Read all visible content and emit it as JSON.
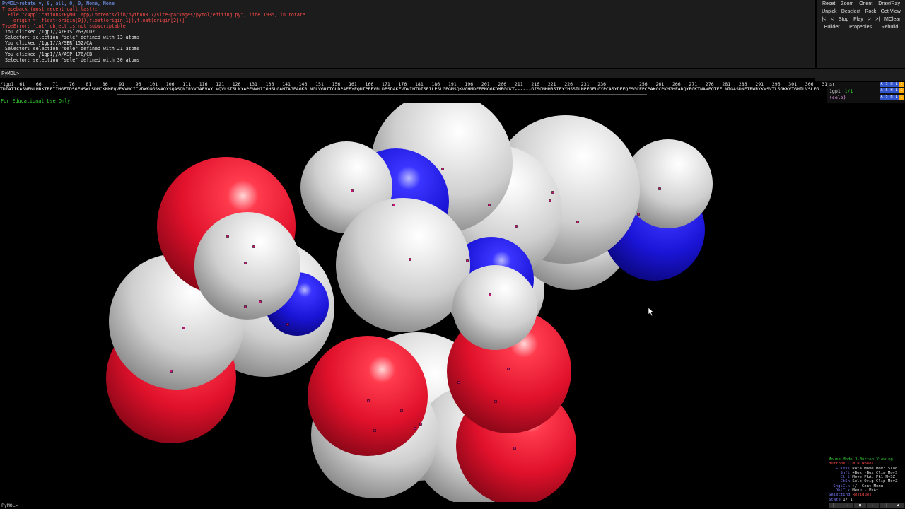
{
  "console": {
    "lines": [
      {
        "text": "PyMOL>rotate y, 0, all, 0, 0, None, None",
        "color": "blue"
      },
      {
        "text": "Traceback (most recent call last):",
        "color": "red"
      },
      {
        "text": "  File \"/Applications/PyMOL.app/Contents/lib/python3.7/site-packages/pymol/editing.py\", line 1935, in rotate",
        "color": "red"
      },
      {
        "text": "    origin = [float(origin[0]),float(origin[1]),float(origin[2])]",
        "color": "red"
      },
      {
        "text": "TypeError: 'int' object is not subscriptable",
        "color": "red"
      },
      {
        "text": " You clicked /1gp1//A/HIS`263/CD2",
        "color": "white"
      },
      {
        "text": " Selector: selection \"sele\" defined with 13 atoms.",
        "color": "white"
      },
      {
        "text": " You clicked /1gp1//A/SER`152/CA",
        "color": "white"
      },
      {
        "text": " Selector: selection \"sele\" defined with 21 atoms.",
        "color": "white"
      },
      {
        "text": " You clicked /1gp1//A/ASP`176/CB",
        "color": "white"
      },
      {
        "text": " Selector: selection \"sele\" defined with 30 atoms.",
        "color": "white"
      }
    ],
    "prompt": "PyMOL>"
  },
  "controls": {
    "row1": [
      "Reset",
      "Zoom",
      "Orient",
      "Draw/Ray"
    ],
    "row2": [
      "Unpick",
      "Deselect",
      "Rock",
      "Get View"
    ],
    "row3": [
      "|<",
      "<",
      "Stop",
      "Play",
      ">",
      ">|",
      "MClear"
    ],
    "row4": [
      "Builder",
      "Properties",
      "Rebuild"
    ]
  },
  "sequence": {
    "numbers": "/1gp1  61    66    71    76    81    86    91    96   101   106   111   116   121   126   131   136   141   146   151   156   161   166   171   176   181   186   191   196   201   206   211   216   221   226   231   236            256   261   266   271   276   281   286   291   296   301   306   311   316   321   326   331   336   341   346   351",
    "residues": "TDIATIKASNFNLHRKTRFIIHGFTDSGENSWLSDMCKNMFQVEKVNCICVDWKGGSKAQYSQASQNIRVVGAEVAYLVQVLSTSLNYAPENVHIIGHSLGAHTAGEAGKRLNGLVGRITGLDPAEPYFQDTPEEVRLDPSDAKFVDVIHTDISPILPSLGFGMSQKVGHMDFFPNGGKDMPGCKT------GISCNHHRSIEYYHSSILNPEGFLGYPCASYDEFQESGCFPCPAKGCPKMGHFADQYPGKTNAVEQTFFLNTGASDNFTRWRYKVSVTLSGKKVTGHILVSLFG"
  },
  "objects": [
    {
      "name": "all",
      "buttons": [
        "A",
        "S",
        "H",
        "L",
        "C"
      ]
    },
    {
      "name": "1gp1",
      "extra": "1/1",
      "buttons": [
        "A",
        "S",
        "H",
        "L",
        "C"
      ]
    },
    {
      "name": "(sele)",
      "buttons": [
        "A",
        "S",
        "H",
        "L",
        "C"
      ]
    }
  ],
  "edu_text": "For Educational Use Only",
  "mouse_panel": {
    "header": "Mouse Mode 3-Button Viewing",
    "buttons_row": "Buttons    L     M     R   Wheel",
    "rows": [
      {
        "key": "& Keys",
        "val": "Rota Move MovZ Slab"
      },
      {
        "key": "Shft",
        "val": "+Box -Box Clip MovS"
      },
      {
        "key": "Ctrl",
        "val": "Move PkAt Pk1  MvSZ"
      },
      {
        "key": "CtSh",
        "val": "Sele Orig Clip MovZ"
      },
      {
        "key": "SnglClk",
        "val": "+/-  Cent Menu"
      },
      {
        "key": "DblClk",
        "val": "Menu  -   PkAt"
      }
    ],
    "selecting_label": "Selecting",
    "selecting_value": "Residues",
    "state_label": "State",
    "state_value": "1/   1"
  },
  "bottom_prompt": "PyMOL>_",
  "playbar": [
    "|◂",
    "◂",
    "■",
    "▸",
    "▸|",
    "⏏"
  ],
  "colors": {
    "carbon": "#d8d8d8",
    "oxygen": "#e0112b",
    "nitrogen": "#1a14d6",
    "console_bg": "#1c1c1c",
    "edu_green": "#33d633"
  }
}
